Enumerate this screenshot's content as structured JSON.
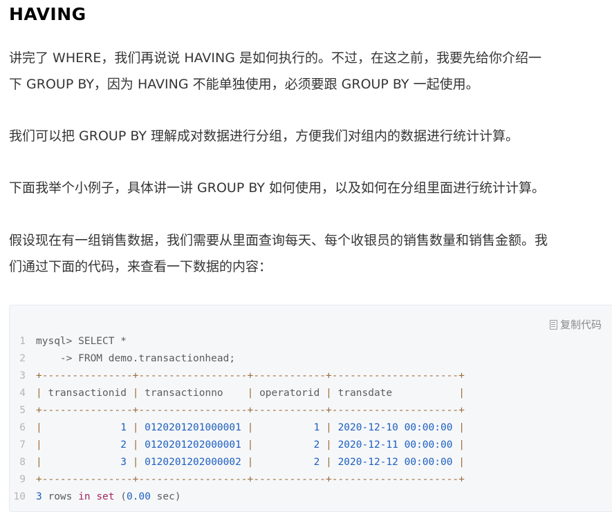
{
  "title": "HAVING",
  "paragraphs": [
    {
      "lines": [
        "讲完了 WHERE，我们再说说 HAVING 是如何执行的。不过，在这之前，我要先给你介绍一",
        "下 GROUP BY，因为 HAVING 不能单独使用，必须要跟 GROUP BY 一起使用。"
      ]
    },
    {
      "lines": [
        "我们可以把 GROUP BY 理解成对数据进行分组，方便我们对组内的数据进行统计计算。"
      ]
    },
    {
      "lines": [
        "下面我举个小例子，具体讲一讲 GROUP BY 如何使用，以及如何在分组里面进行统计计算。"
      ]
    },
    {
      "lines": [
        "假设现在有一组销售数据，我们需要从里面查询每天、每个收银员的销售数量和销售金额。我",
        "们通过下面的代码，来查看一下数据的内容："
      ]
    }
  ],
  "code_block": {
    "copy_label": "复制代码",
    "copy_icon": "copy-document-icon",
    "colors": {
      "border_chars": "#9a6e3a",
      "numbers": "#1c5fbf",
      "keywords": "#a1295e",
      "text": "#5c5c5c",
      "line_numbers": "#b5b5b5"
    },
    "line_numbers": [
      "1",
      "2",
      "3",
      "4",
      "5",
      "6",
      "7",
      "8",
      "9",
      "10"
    ],
    "query": {
      "prompt": "mysql> SELECT *",
      "continuation": "    -> FROM demo.transactionhead;"
    },
    "separator": "+---------------+------------------+------------+---------------------+",
    "columns": [
      "transactionid",
      "transactionno",
      "operatorid",
      "transdate"
    ],
    "rows": [
      {
        "transactionid": "1",
        "transactionno": "0120201201000001",
        "operatorid": "1",
        "transdate": "2020-12-10 00:00:00"
      },
      {
        "transactionid": "2",
        "transactionno": "0120201202000001",
        "operatorid": "2",
        "transdate": "2020-12-11 00:00:00"
      },
      {
        "transactionid": "3",
        "transactionno": "0120201202000002",
        "operatorid": "2",
        "transdate": "2020-12-12 00:00:00"
      }
    ],
    "result_summary": {
      "count": "3",
      "rows_word": "rows",
      "in": "in",
      "set": "set",
      "time": "0.00",
      "unit": "sec"
    }
  }
}
